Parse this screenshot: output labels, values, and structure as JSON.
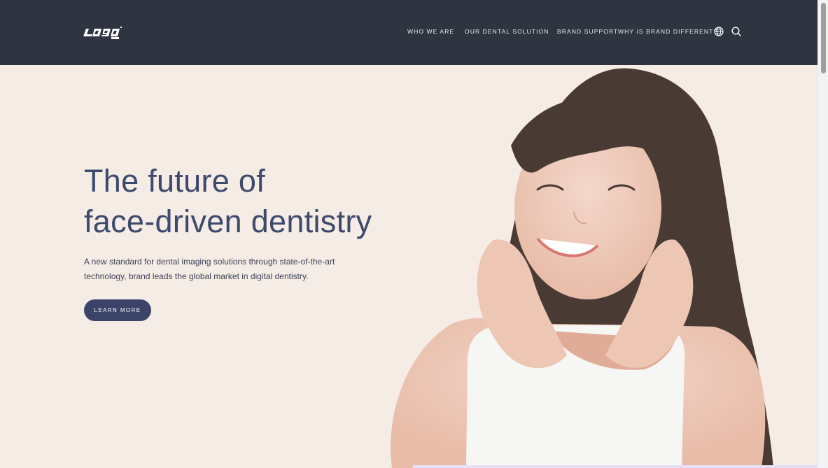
{
  "header": {
    "brand_logo_text": "Logo",
    "nav": [
      {
        "label": "WHO WE ARE"
      },
      {
        "label": "OUR DENTAL SOLUTION"
      },
      {
        "label": "BRAND SUPPORT"
      },
      {
        "label": "WHY IS BRAND DIFFERENT?"
      }
    ],
    "icons": [
      "globe-icon",
      "search-icon"
    ]
  },
  "hero": {
    "title_line1": "The future of",
    "title_line2": "face-driven dentistry",
    "subtitle_line1": "A new standard for dental imaging solutions through state-of-the-art",
    "subtitle_line2": "technology, brand leads the global market in digital dentistry.",
    "cta_label": "LEARN MORE"
  },
  "colors": {
    "header_bg": "#2f3441",
    "hero_bg": "#f6ece6",
    "title": "#3e4a6d",
    "button": "#3b4468"
  }
}
